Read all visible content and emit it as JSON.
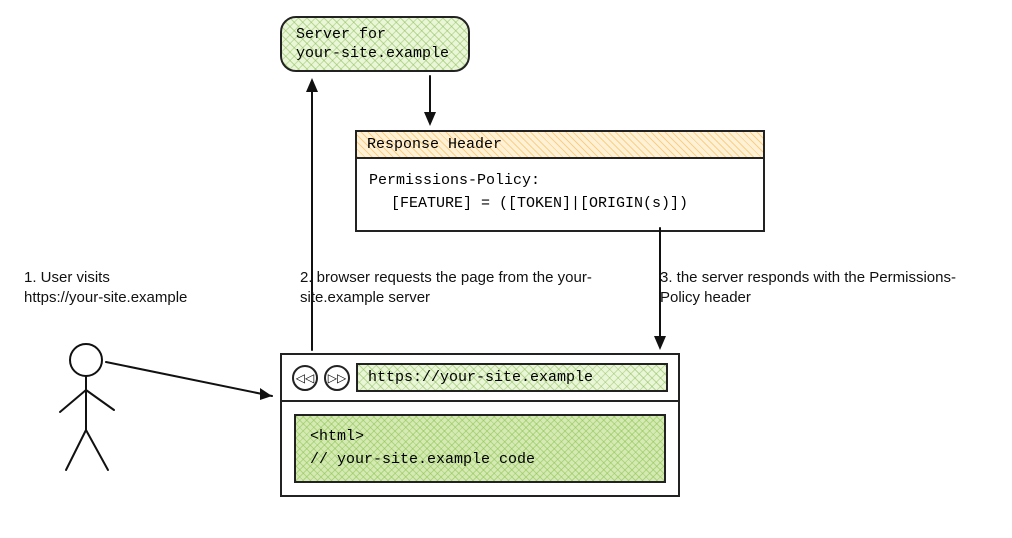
{
  "server": {
    "line1": "Server for",
    "line2": "your-site.example"
  },
  "response_header": {
    "title": "Response Header",
    "line1": "Permissions-Policy:",
    "line2": "[FEATURE] = ([TOKEN]|[ORIGIN(s)])"
  },
  "steps": {
    "s1_prefix": "1. User visits",
    "s1_url": "https://your-site.example",
    "s2": "2. browser requests the page from the your-site.example server",
    "s3": "3. the server responds with the Permissions-Policy header"
  },
  "browser": {
    "back_glyph": "◁◁",
    "fwd_glyph": "▷▷",
    "url": "https://your-site.example",
    "code_line1": "<html>",
    "code_line2": "// your-site.example code"
  },
  "actors": {
    "user": "user-figure"
  }
}
